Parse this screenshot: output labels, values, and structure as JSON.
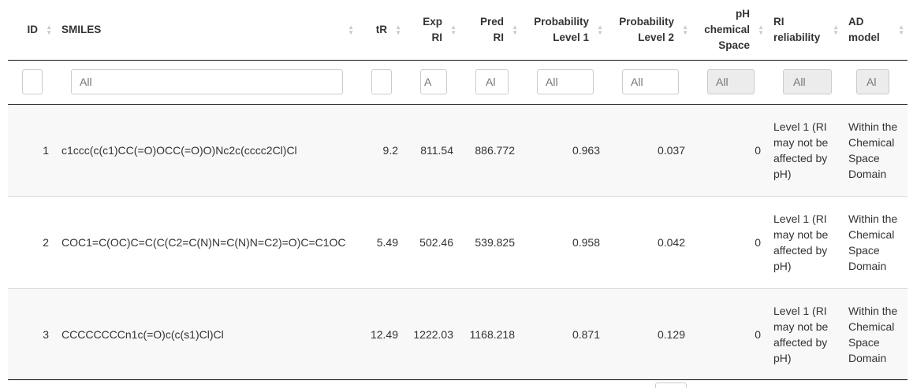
{
  "columns": [
    {
      "key": "id",
      "lines": [
        "ID"
      ]
    },
    {
      "key": "smiles",
      "lines": [
        "SMILES"
      ]
    },
    {
      "key": "tr",
      "lines": [
        "tR"
      ]
    },
    {
      "key": "exp_ri",
      "lines": [
        "Exp",
        "RI"
      ]
    },
    {
      "key": "pred_ri",
      "lines": [
        "Pred",
        "RI"
      ]
    },
    {
      "key": "prob1",
      "lines": [
        "Probability",
        "Level 1"
      ]
    },
    {
      "key": "prob2",
      "lines": [
        "Probability",
        "Level 2"
      ]
    },
    {
      "key": "ph",
      "lines": [
        "pH",
        "chemical",
        "Space"
      ]
    },
    {
      "key": "ri_rel",
      "lines": [
        "RI",
        "reliability"
      ]
    },
    {
      "key": "ad",
      "lines": [
        "AD",
        "model"
      ]
    }
  ],
  "filters": {
    "id": "",
    "smiles": "All",
    "tr": "",
    "exp_ri": "A",
    "pred_ri": "Al",
    "prob1": "All",
    "prob2": "All",
    "ph": "All",
    "ri_rel": "All",
    "ad": "Al"
  },
  "rows": [
    {
      "id": "1",
      "smiles": "c1ccc(c(c1)CC(=O)OCC(=O)O)Nc2c(cccc2Cl)Cl",
      "tr": "9.2",
      "exp_ri": "811.54",
      "pred_ri": "886.772",
      "prob1": "0.963",
      "prob2": "0.037",
      "ph": "0",
      "ri_rel": "Level 1 (RI may not be affected by pH)",
      "ad": "Within the Chemical Space Domain"
    },
    {
      "id": "2",
      "smiles": "COC1=C(OC)C=C(C(C2=C(N)N=C(N)N=C2)=O)C=C1OC",
      "tr": "5.49",
      "exp_ri": "502.46",
      "pred_ri": "539.825",
      "prob1": "0.958",
      "prob2": "0.042",
      "ph": "0",
      "ri_rel": "Level 1 (RI may not be affected by pH)",
      "ad": "Within the Chemical Space Domain"
    },
    {
      "id": "3",
      "smiles": "CCCCCCCCn1c(=O)c(c(s1)Cl)Cl",
      "tr": "12.49",
      "exp_ri": "1222.03",
      "pred_ri": "1168.218",
      "prob1": "0.871",
      "prob2": "0.129",
      "ph": "0",
      "ri_rel": "Level 1 (RI may not be affected by pH)",
      "ad": "Within the Chemical Space Domain"
    }
  ]
}
